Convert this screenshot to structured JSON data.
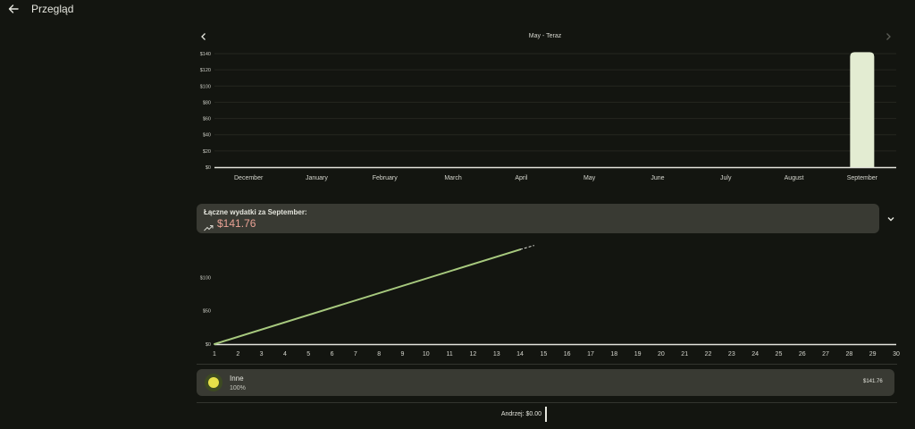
{
  "header": {
    "title": "Przegląd"
  },
  "range": {
    "label": "May - Teraz"
  },
  "monthly_chart": {
    "type": "bar",
    "categories": [
      "December",
      "January",
      "February",
      "March",
      "April",
      "May",
      "June",
      "July",
      "August",
      "September"
    ],
    "values": [
      0,
      0,
      0,
      0,
      0,
      0,
      0,
      0,
      0,
      141.76
    ],
    "yticks": [
      "$0",
      "$20",
      "$40",
      "$60",
      "$80",
      "$100",
      "$120",
      "$140"
    ],
    "ylim": [
      0,
      140
    ],
    "grid": true,
    "bar_color": "#e3ecd2"
  },
  "summary": {
    "label": "Łączne wydatki za September:",
    "value": "$141.76",
    "value_color": "#e9a295"
  },
  "daily_chart": {
    "type": "line",
    "x_labels": [
      "1",
      "2",
      "3",
      "4",
      "5",
      "6",
      "7",
      "8",
      "9",
      "10",
      "11",
      "12",
      "13",
      "14",
      "15",
      "16",
      "17",
      "18",
      "19",
      "20",
      "21",
      "22",
      "23",
      "24",
      "25",
      "26",
      "27",
      "28",
      "29",
      "30"
    ],
    "yticks": [
      "$0",
      "$50",
      "$100"
    ],
    "ylim": [
      0,
      150
    ],
    "xlim": [
      1,
      30
    ],
    "line_color": "#a7c97e",
    "series": [
      {
        "x": [
          1,
          14
        ],
        "y": [
          0,
          141.76
        ]
      }
    ],
    "projection": {
      "x": [
        14,
        14.6
      ],
      "y": [
        141.76,
        147.8
      ]
    }
  },
  "categories_list": [
    {
      "name": "Inne",
      "percent": "100%",
      "amount": "$141.76",
      "color": "#e6e04a"
    }
  ],
  "footer": {
    "user_total": "Andrzej: $0.00"
  }
}
